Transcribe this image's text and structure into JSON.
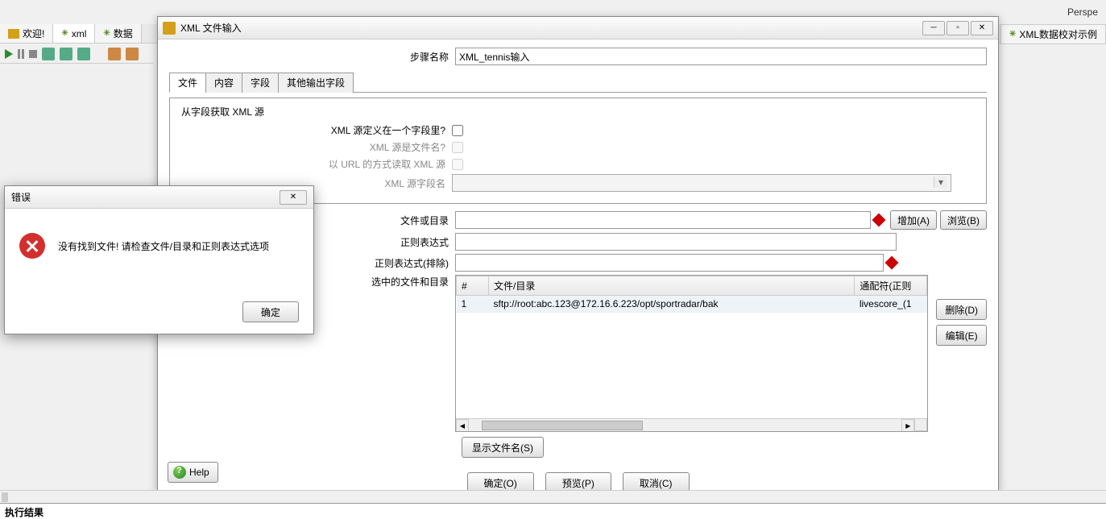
{
  "perspective": "Perspe",
  "bgTabs": [
    {
      "label": "欢迎!",
      "icon": "home"
    },
    {
      "label": "xml",
      "icon": "xml"
    },
    {
      "label": "数据",
      "icon": "xml"
    }
  ],
  "rightTab": "XML数据校对示例",
  "dialog": {
    "title": "XML 文件输入",
    "stepLabel": "步骤名称",
    "stepValue": "XML_tennis输入",
    "tabs": [
      "文件",
      "内容",
      "字段",
      "其他输出字段"
    ],
    "fieldset": {
      "legend": "从字段获取 XML 源",
      "row1": "XML 源定义在一个字段里?",
      "row2": "XML 源是文件名?",
      "row3": "以 URL 的方式读取 XML 源",
      "row4": "XML 源字段名"
    },
    "fileRows": {
      "fileOrDir": "文件或目录",
      "regex": "正则表达式",
      "regexExclude": "正则表达式(排除)",
      "selected": "选中的文件和目录",
      "addBtn": "增加(A)",
      "browseBtn": "浏览(B)"
    },
    "table": {
      "col1": "#",
      "col2": "文件/目录",
      "col3": "通配符(正则",
      "rows": [
        {
          "idx": "1",
          "path": "sftp://root:abc.123@172.16.6.223/opt/sportradar/bak",
          "wildcard": "livescore_(1"
        }
      ],
      "deleteBtn": "删除(D)",
      "editBtn": "编辑(E)"
    },
    "showFilesBtn": "显示文件名(S)",
    "okBtn": "确定(O)",
    "previewBtn": "预览(P)",
    "cancelBtn": "取消(C)",
    "helpBtn": "Help"
  },
  "errorDialog": {
    "title": "错误",
    "message": "没有找到文件! 请检查文件/目录和正则表达式选项",
    "okBtn": "确定"
  },
  "execResult": "执行结果"
}
